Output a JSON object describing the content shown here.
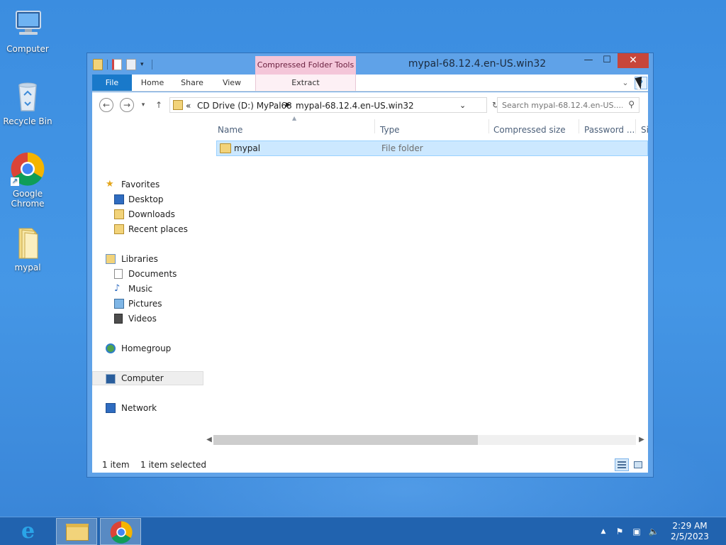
{
  "desktop": {
    "icons": [
      {
        "label": "Computer"
      },
      {
        "label": "Recycle Bin"
      },
      {
        "label": "Google Chrome"
      },
      {
        "label": "mypal"
      }
    ]
  },
  "window": {
    "title": "mypal-68.12.4.en-US.win32",
    "context_tab_group": "Compressed Folder Tools",
    "controls": {
      "minimize": "—",
      "maximize": "☐",
      "close": "✕"
    },
    "ribbon_tabs": [
      {
        "label": "File"
      },
      {
        "label": "Home"
      },
      {
        "label": "Share"
      },
      {
        "label": "View"
      },
      {
        "label": "Extract"
      }
    ],
    "address": {
      "overflow": "«",
      "segments": [
        "CD Drive (D:) MyPal68",
        "mypal-68.12.4.en-US.win32"
      ]
    },
    "search": {
      "placeholder": "Search mypal-68.12.4.en-US...."
    },
    "nav_pane": {
      "favorites": {
        "label": "Favorites",
        "items": [
          "Desktop",
          "Downloads",
          "Recent places"
        ]
      },
      "libraries": {
        "label": "Libraries",
        "items": [
          "Documents",
          "Music",
          "Pictures",
          "Videos"
        ]
      },
      "homegroup": "Homegroup",
      "computer": "Computer",
      "network": "Network"
    },
    "columns": [
      "Name",
      "Type",
      "Compressed size",
      "Password ...",
      "Si"
    ],
    "files": [
      {
        "name": "mypal",
        "type": "File folder"
      }
    ],
    "status": {
      "count": "1 item",
      "selected": "1 item selected"
    }
  },
  "taskbar": {
    "time": "2:29 AM",
    "date": "2/5/2023"
  },
  "colors": {
    "accent": "#1979ca",
    "selection": "#cce8ff",
    "context_tab": "#f4c6d9",
    "close": "#c7463a"
  }
}
